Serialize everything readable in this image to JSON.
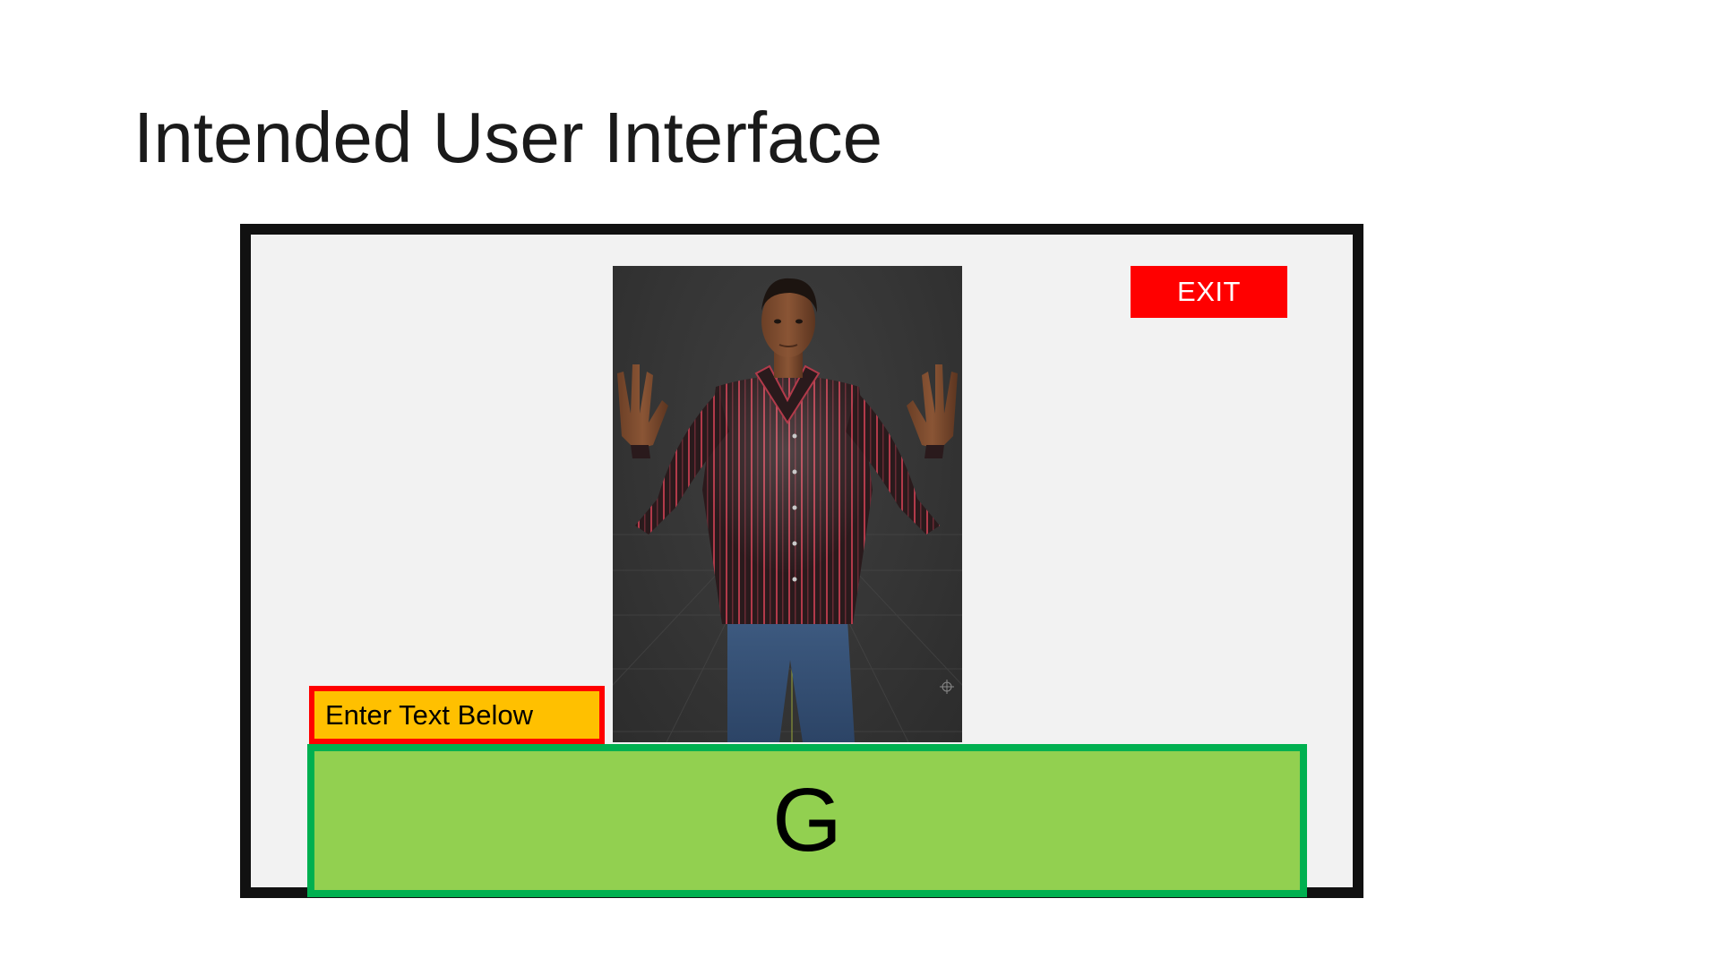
{
  "slide": {
    "title": "Intended User Interface"
  },
  "mockup": {
    "exit_label": "EXIT",
    "input_label": "Enter Text Below",
    "display_text": "G",
    "avatar_description_icon": "signing-avatar"
  },
  "colors": {
    "exit_background": "#ff0000",
    "label_background": "#ffc000",
    "label_border": "#ff0000",
    "display_background": "#92d050",
    "display_border": "#00b050",
    "frame_border": "#111111",
    "frame_background": "#f2f2f2"
  }
}
